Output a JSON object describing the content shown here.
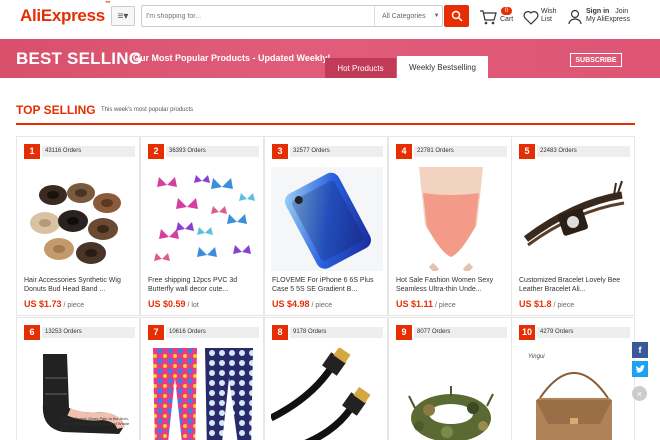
{
  "header": {
    "logo": "AliExpress",
    "search_placeholder": "I'm shopping for...",
    "search_category": "All Categories",
    "cart_count": "0",
    "cart_label": "Cart",
    "wish_label_1": "Wish",
    "wish_label_2": "List",
    "signin": "Sign in",
    "join": "Join",
    "my_account": "My AliExpress",
    "accent_color": "#e62e04"
  },
  "banner": {
    "title": "BEST SELLING",
    "subtitle": "Our Most Popular Products - Updated Weekly!",
    "tab_hot": "Hot Products",
    "tab_weekly": "Weekly Bestselling",
    "subscribe": "SUBSCRIBE",
    "color": "#d8506b"
  },
  "section": {
    "title": "TOP SELLING",
    "subtitle": "This week's most popular products"
  },
  "products": [
    {
      "rank": "1",
      "orders": "43116 Orders",
      "title": "Hair Accessories Synthetic Wig Donuts Bud Head Band ...",
      "price": "US $1.73",
      "unit": " / piece",
      "image": "hair-donut-buns"
    },
    {
      "rank": "2",
      "orders": "36393 Orders",
      "title": "Free shipping 12pcs PVC 3d Butterfly wall decor cute...",
      "price": "US $0.59",
      "unit": " / lot",
      "image": "butterfly-wall-decor"
    },
    {
      "rank": "3",
      "orders": "32577 Orders",
      "title": "FLOVEME For iPhone 6 6S Plus Case 5 5S SE Gradient B...",
      "price": "US $4.98",
      "unit": " / piece",
      "image": "phone-case"
    },
    {
      "rank": "4",
      "orders": "22781 Orders",
      "title": "Hot Sale Fashion Women Sexy Seamless Ultra-thin Unde...",
      "price": "US $1.11",
      "unit": " / piece",
      "image": "underwear"
    },
    {
      "rank": "5",
      "orders": "22483 Orders",
      "title": "Customized Bracelet Lovely Bee Leather Bracelet Ali...",
      "price": "US $1.8",
      "unit": " / piece",
      "image": "leather-bracelet"
    },
    {
      "rank": "6",
      "orders": "13253 Orders",
      "title": "",
      "price": "",
      "unit": "",
      "image": "ankle-sleeve",
      "img_caption": "7 Zone Design Gives Pain to the Arch, Plantar Fascia, Heel, Ankle and Whole Foot"
    },
    {
      "rank": "7",
      "orders": "10616 Orders",
      "title": "",
      "price": "",
      "unit": "",
      "image": "printed-leggings"
    },
    {
      "rank": "8",
      "orders": "9178 Orders",
      "title": "",
      "price": "",
      "unit": "",
      "image": "hdmi-cable"
    },
    {
      "rank": "9",
      "orders": "8077 Orders",
      "title": "",
      "price": "",
      "unit": "",
      "image": "camo-hat"
    },
    {
      "rank": "10",
      "orders": "4279 Orders",
      "title": "",
      "price": "",
      "unit": "",
      "image": "brown-handbag",
      "img_brand": "Yingui"
    }
  ],
  "social": {
    "facebook": "f",
    "twitter": "t",
    "close": "×"
  }
}
